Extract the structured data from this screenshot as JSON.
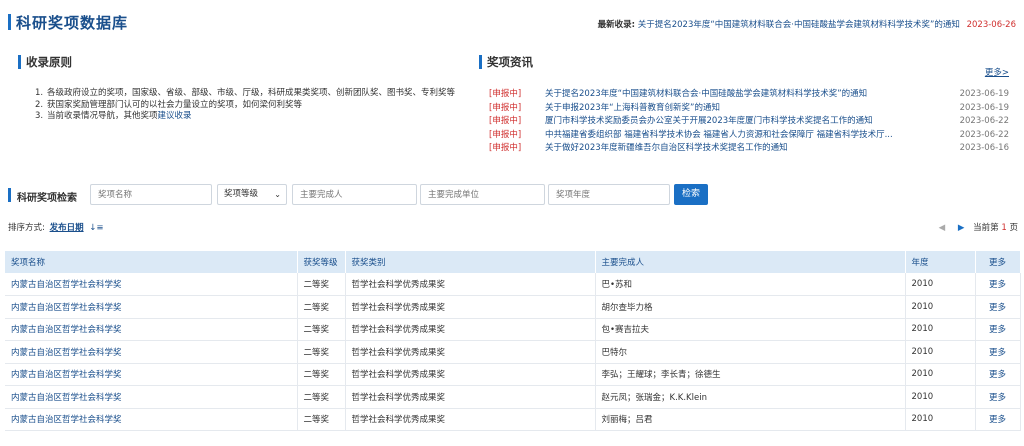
{
  "header": {
    "title": "科研奖项数据库",
    "latest_label": "最新收录:",
    "latest_text": "关于提名2023年度“中国建筑材料联合会·中国硅酸盐学会建筑材料科学技术奖”的通知",
    "latest_date": "2023-06-26"
  },
  "principles": {
    "heading": "收录原则",
    "items": [
      {
        "num": "1.",
        "text": "各级政府设立的奖项，国家级、省级、部级、市级、厅级，科研成果类奖项、创新团队奖、图书奖、专利奖等"
      },
      {
        "num": "2.",
        "text": "获国家奖励管理部门认可的以社会力量设立的奖项，如何梁何利奖等"
      },
      {
        "num": "3.",
        "text_before": "当前收录情况导航，其他奖项",
        "text_link": "建议收录"
      }
    ]
  },
  "news": {
    "heading": "奖项资讯",
    "more": "更多>",
    "items": [
      {
        "tag": "[申报中]",
        "title": "关于提名2023年度“中国建筑材料联合会·中国硅酸盐学会建筑材料科学技术奖”的通知",
        "date": "2023-06-19"
      },
      {
        "tag": "[申报中]",
        "title": "关于申报2023年“上海科普教育创新奖”的通知",
        "date": "2023-06-19"
      },
      {
        "tag": "[申报中]",
        "title": "厦门市科学技术奖励委员会办公室关于开展2023年度厦门市科学技术奖提名工作的通知",
        "date": "2023-06-22"
      },
      {
        "tag": "[申报中]",
        "title": "中共福建省委组织部 福建省科学技术协会 福建省人力资源和社会保障厅 福建省科学技术厅...",
        "date": "2023-06-22"
      },
      {
        "tag": "[申报中]",
        "title": "关于做好2023年度新疆维吾尔自治区科学技术奖提名工作的通知",
        "date": "2023-06-16"
      }
    ]
  },
  "search": {
    "label": "科研奖项检索",
    "award_name_placeholder": "奖项名称",
    "level_select": "奖项等级",
    "person_placeholder": "主要完成人",
    "unit_placeholder": "主要完成单位",
    "year_placeholder": "奖项年度",
    "button": "检索"
  },
  "sort": {
    "label": "排序方式:",
    "value": "发布日期",
    "icon": "sort-icon"
  },
  "pager": {
    "current_prefix": "当前第",
    "current_page": "1",
    "current_suffix": "页"
  },
  "table": {
    "headers": [
      "奖项名称",
      "获奖等级",
      "获奖类别",
      "主要完成人",
      "年度",
      "更多"
    ],
    "rows": [
      {
        "name": "内蒙古自治区哲学社会科学奖",
        "level": "二等奖",
        "category": "哲学社会科学优秀成果奖",
        "person": "巴•苏和",
        "year": "2010",
        "more": "更多"
      },
      {
        "name": "内蒙古自治区哲学社会科学奖",
        "level": "二等奖",
        "category": "哲学社会科学优秀成果奖",
        "person": "胡尔查毕力格",
        "year": "2010",
        "more": "更多"
      },
      {
        "name": "内蒙古自治区哲学社会科学奖",
        "level": "二等奖",
        "category": "哲学社会科学优秀成果奖",
        "person": "包•赛吉拉夫",
        "year": "2010",
        "more": "更多"
      },
      {
        "name": "内蒙古自治区哲学社会科学奖",
        "level": "二等奖",
        "category": "哲学社会科学优秀成果奖",
        "person": "巴特尔",
        "year": "2010",
        "more": "更多"
      },
      {
        "name": "内蒙古自治区哲学社会科学奖",
        "level": "二等奖",
        "category": "哲学社会科学优秀成果奖",
        "person": "李弘；王耀球；李长青；徐德生",
        "year": "2010",
        "more": "更多"
      },
      {
        "name": "内蒙古自治区哲学社会科学奖",
        "level": "二等奖",
        "category": "哲学社会科学优秀成果奖",
        "person": "赵元凤；张瑞金；K.K.Klein",
        "year": "2010",
        "more": "更多"
      },
      {
        "name": "内蒙古自治区哲学社会科学奖",
        "level": "二等奖",
        "category": "哲学社会科学优秀成果奖",
        "person": "刘丽梅；吕君",
        "year": "2010",
        "more": "更多"
      }
    ]
  }
}
